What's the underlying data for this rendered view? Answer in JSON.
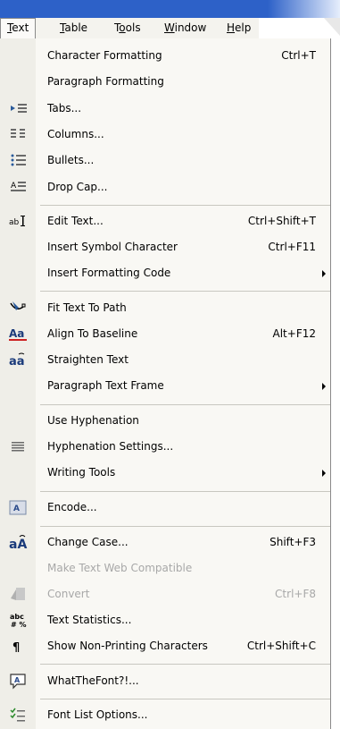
{
  "menubar": [
    {
      "pre": "",
      "key": "T",
      "post": "ext",
      "active": true
    },
    {
      "pre": "",
      "key": "T",
      "post": "able",
      "active": false
    },
    {
      "pre": "T",
      "key": "o",
      "post": "ols",
      "active": false
    },
    {
      "pre": "",
      "key": "W",
      "post": "indow",
      "active": false
    },
    {
      "pre": "",
      "key": "H",
      "post": "elp",
      "active": false
    }
  ],
  "items": [
    {
      "label": "Character Formatting",
      "shortcut": "Ctrl+T",
      "icon": "",
      "enabled": true,
      "submenu": false
    },
    {
      "label": "Paragraph Formatting",
      "shortcut": "",
      "icon": "",
      "enabled": true,
      "submenu": false
    },
    {
      "label": "Tabs...",
      "shortcut": "",
      "icon": "tabs-icon",
      "enabled": true,
      "submenu": false
    },
    {
      "label": "Columns...",
      "shortcut": "",
      "icon": "columns-icon",
      "enabled": true,
      "submenu": false
    },
    {
      "label": "Bullets...",
      "shortcut": "",
      "icon": "bullets-icon",
      "enabled": true,
      "submenu": false
    },
    {
      "label": "Drop Cap...",
      "shortcut": "",
      "icon": "drop-cap-icon",
      "enabled": true,
      "submenu": false
    },
    {
      "label": "Edit Text...",
      "shortcut": "Ctrl+Shift+T",
      "icon": "edit-text-icon",
      "enabled": true,
      "submenu": false
    },
    {
      "label": "Insert Symbol Character",
      "shortcut": "Ctrl+F11",
      "icon": "",
      "enabled": true,
      "submenu": false
    },
    {
      "label": "Insert Formatting Code",
      "shortcut": "",
      "icon": "",
      "enabled": true,
      "submenu": true
    },
    {
      "label": "Fit Text To Path",
      "shortcut": "",
      "icon": "fit-text-to-path-icon",
      "enabled": true,
      "submenu": false
    },
    {
      "label": "Align To Baseline",
      "shortcut": "Alt+F12",
      "icon": "align-baseline-icon",
      "enabled": true,
      "submenu": false
    },
    {
      "label": "Straighten Text",
      "shortcut": "",
      "icon": "straighten-text-icon",
      "enabled": true,
      "submenu": false
    },
    {
      "label": "Paragraph Text Frame",
      "shortcut": "",
      "icon": "",
      "enabled": true,
      "submenu": true
    },
    {
      "label": "Use Hyphenation",
      "shortcut": "",
      "icon": "",
      "enabled": true,
      "submenu": false
    },
    {
      "label": "Hyphenation Settings...",
      "shortcut": "",
      "icon": "hyphenation-icon",
      "enabled": true,
      "submenu": false
    },
    {
      "label": "Writing Tools",
      "shortcut": "",
      "icon": "",
      "enabled": true,
      "submenu": true
    },
    {
      "label": "Encode...",
      "shortcut": "",
      "icon": "encode-icon",
      "enabled": true,
      "submenu": false
    },
    {
      "label": "Change Case...",
      "shortcut": "Shift+F3",
      "icon": "change-case-icon",
      "enabled": true,
      "submenu": false
    },
    {
      "label": "Make Text Web Compatible",
      "shortcut": "",
      "icon": "",
      "enabled": false,
      "submenu": false
    },
    {
      "label": "Convert",
      "shortcut": "Ctrl+F8",
      "icon": "convert-icon",
      "enabled": false,
      "submenu": false
    },
    {
      "label": "Text Statistics...",
      "shortcut": "",
      "icon": "text-statistics-icon",
      "enabled": true,
      "submenu": false
    },
    {
      "label": "Show Non-Printing Characters",
      "shortcut": "Ctrl+Shift+C",
      "icon": "pilcrow-icon",
      "enabled": true,
      "submenu": false
    },
    {
      "label": "WhatTheFont?!...",
      "shortcut": "",
      "icon": "whatthefont-icon",
      "enabled": true,
      "submenu": false
    },
    {
      "label": "Font List Options...",
      "shortcut": "",
      "icon": "font-list-icon",
      "enabled": true,
      "submenu": false
    }
  ]
}
